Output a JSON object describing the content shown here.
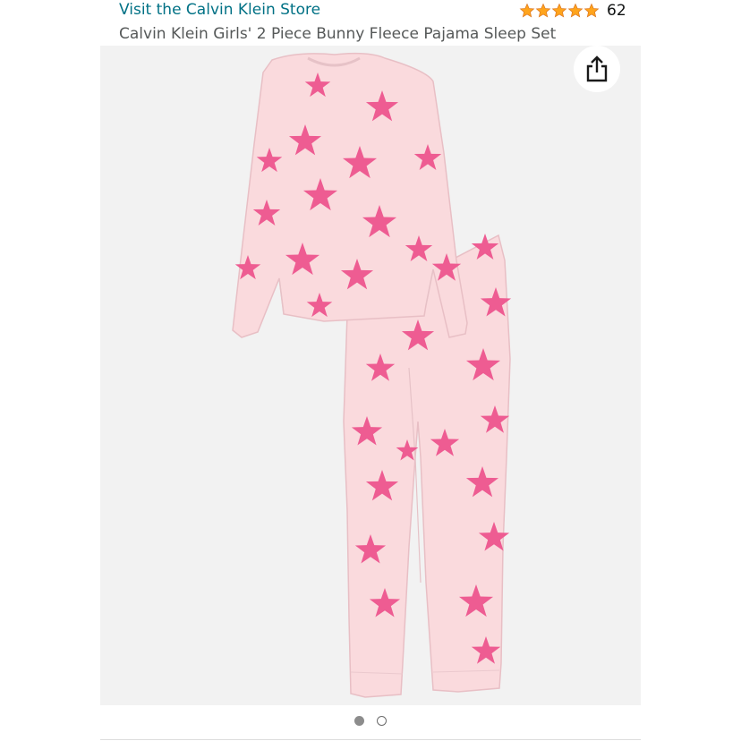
{
  "header": {
    "store_link": "Visit the Calvin Klein Store",
    "rating": {
      "stars": 5,
      "count": "62"
    },
    "product_title": "Calvin Klein Girls' 2 Piece Bunny Fleece Pajama Sleep Set"
  },
  "gallery": {
    "share_icon": "share-icon",
    "image_count": 2,
    "active_index": 0
  },
  "colors": {
    "link": "#007185",
    "star": "#FFA41C",
    "star_outline": "#DE7921",
    "title": "#565959",
    "pajama_base": "#F9DCDC",
    "star_print": "#EE5C92"
  }
}
